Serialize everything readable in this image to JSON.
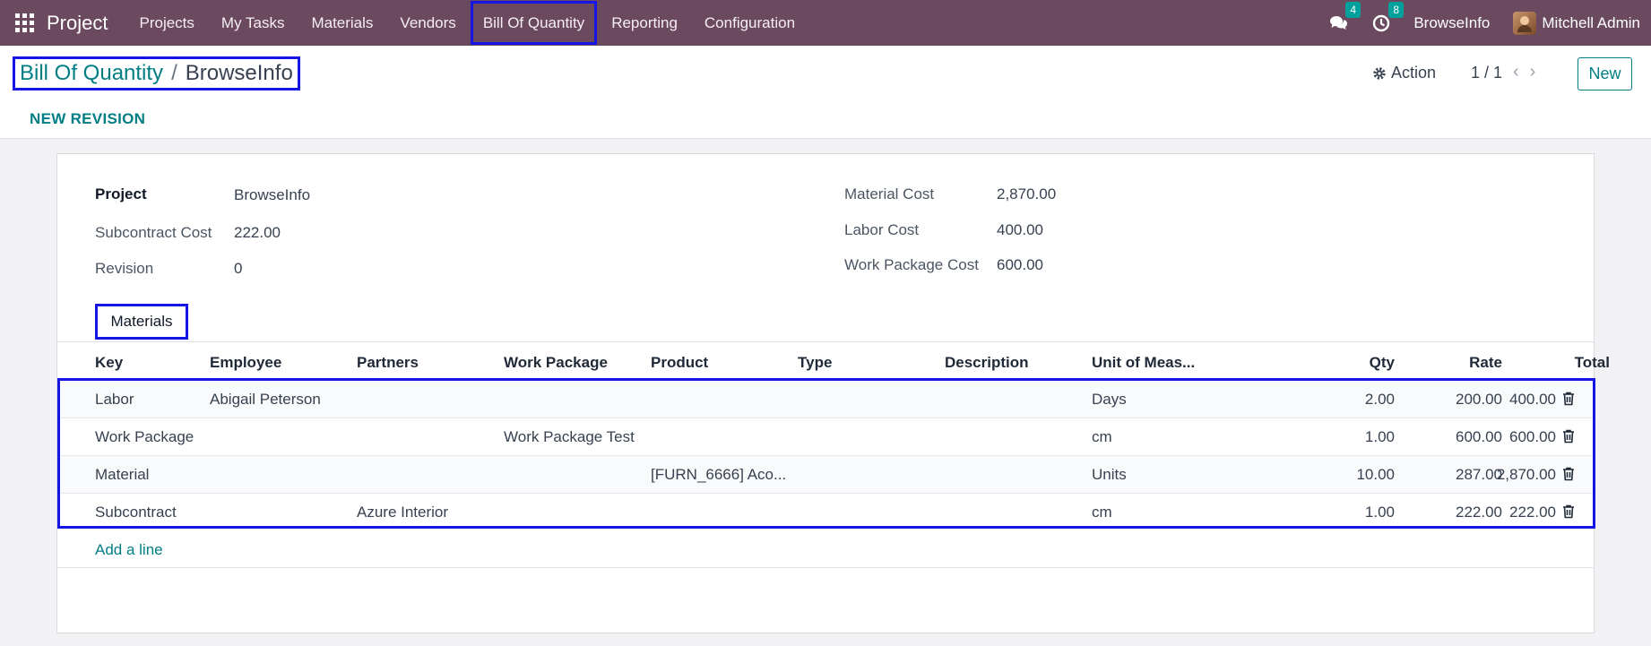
{
  "navbar": {
    "brand": "Project",
    "menu": [
      "Projects",
      "My Tasks",
      "Materials",
      "Vendors",
      "Bill Of Quantity",
      "Reporting",
      "Configuration"
    ],
    "messages_count": "4",
    "activities_count": "8",
    "company": "BrowseInfo",
    "user": "Mitchell Admin"
  },
  "control": {
    "breadcrumb_parent": "Bill Of Quantity",
    "breadcrumb_sep": "/",
    "breadcrumb_current": "BrowseInfo",
    "action_label": "Action",
    "pager": "1 / 1",
    "new_label": "New",
    "revision_label": "NEW REVISION"
  },
  "form": {
    "project_label": "Project",
    "project_value": "BrowseInfo",
    "subcontract_label": "Subcontract Cost",
    "subcontract_value": "222.00",
    "revision_label": "Revision",
    "revision_value": "0",
    "material_cost_label": "Material Cost",
    "material_cost_value": "2,870.00",
    "labor_cost_label": "Labor Cost",
    "labor_cost_value": "400.00",
    "wp_cost_label": "Work Package Cost",
    "wp_cost_value": "600.00"
  },
  "tab": {
    "label": "Materials"
  },
  "table": {
    "headers": {
      "key": "Key",
      "employee": "Employee",
      "partners": "Partners",
      "work_package": "Work Package",
      "product": "Product",
      "type": "Type",
      "description": "Description",
      "uom": "Unit of Meas...",
      "qty": "Qty",
      "rate": "Rate",
      "total": "Total"
    },
    "rows": [
      {
        "key": "Labor",
        "employee": "Abigail Peterson",
        "partners": "",
        "work_package": "",
        "product": "",
        "uom": "Days",
        "qty": "2.00",
        "rate": "200.00",
        "total": "400.00"
      },
      {
        "key": "Work Package",
        "employee": "",
        "partners": "",
        "work_package": "Work Package Test",
        "product": "",
        "uom": "cm",
        "qty": "1.00",
        "rate": "600.00",
        "total": "600.00"
      },
      {
        "key": "Material",
        "employee": "",
        "partners": "",
        "work_package": "",
        "product": "[FURN_6666] Aco...",
        "uom": "Units",
        "qty": "10.00",
        "rate": "287.00",
        "total": "2,870.00"
      },
      {
        "key": "Subcontract",
        "employee": "",
        "partners": "Azure Interior",
        "work_package": "",
        "product": "",
        "uom": "cm",
        "qty": "1.00",
        "rate": "222.00",
        "total": "222.00"
      }
    ],
    "add_line": "Add a line"
  },
  "colors": {
    "navbar": "#6b4a5f",
    "accent": "#017e84",
    "highlight": "#1515e6",
    "badge": "#00a09d"
  }
}
